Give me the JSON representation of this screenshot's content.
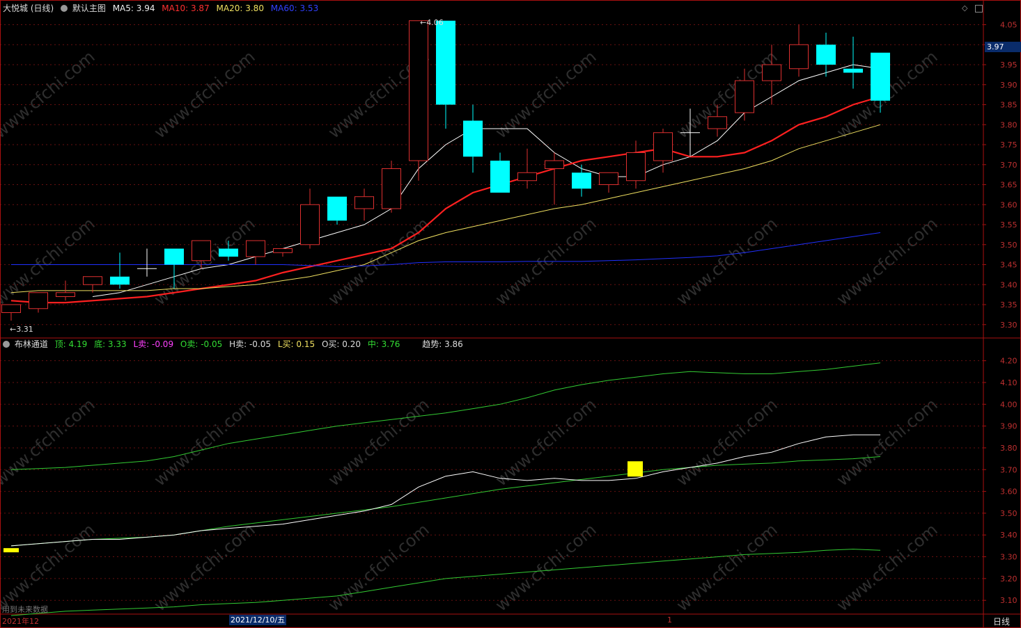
{
  "header": {
    "stock": "大悦城 (日线)",
    "main_chart": "默认主图",
    "ma5": "MA5: 3.94",
    "ma10": "MA10: 3.87",
    "ma20": "MA20: 3.80",
    "ma60": "MA60: 3.53"
  },
  "indicator_header": {
    "name": "布林通道",
    "top": "顶: 4.19",
    "bottom": "底: 3.33",
    "l_sell": "L卖: -0.09",
    "o_sell": "O卖: -0.05",
    "h_sell": "H卖: -0.05",
    "l_buy": "L买: 0.15",
    "o_buy": "O买: 0.20",
    "mid": "中: 3.76",
    "trend": "趋势: 3.86"
  },
  "footer": {
    "future_data": "用到未来数据",
    "month_label": "2021年12",
    "date_label": "2021/12/10/五",
    "month_mark": "1",
    "period": "日线"
  },
  "price_box": "3.97",
  "watermark": "www.cfchi.com",
  "colors": {
    "up": "#e03030",
    "down": "#00ffff",
    "ma5": "#ffffff",
    "ma10": "#ff2020",
    "ma20": "#f0e060",
    "ma60": "#2030ff",
    "boll": "#33cc33",
    "trend": "#ffffff",
    "signal": "#ffff00",
    "axis": "#aa1010",
    "grid": "#6a1010"
  },
  "chart_data": [
    {
      "type": "candlestick",
      "title": "大悦城 (日线)",
      "ylim": [
        3.27,
        4.07
      ],
      "yticks": [
        3.3,
        3.35,
        3.4,
        3.45,
        3.5,
        3.55,
        3.6,
        3.65,
        3.7,
        3.75,
        3.8,
        3.85,
        3.9,
        3.95,
        4.0,
        4.05
      ],
      "grid": true,
      "annotations": [
        {
          "text": "←3.31",
          "x": 0,
          "y": 3.31
        },
        {
          "text": "←4.06",
          "x": 15,
          "y": 4.06
        }
      ],
      "ohlc": [
        [
          3.33,
          3.35,
          3.31,
          3.35
        ],
        [
          3.34,
          3.38,
          3.33,
          3.38
        ],
        [
          3.37,
          3.41,
          3.36,
          3.38
        ],
        [
          3.4,
          3.42,
          3.38,
          3.42
        ],
        [
          3.42,
          3.48,
          3.39,
          3.4
        ],
        [
          3.44,
          3.49,
          3.42,
          3.44
        ],
        [
          3.49,
          3.49,
          3.39,
          3.45
        ],
        [
          3.46,
          3.51,
          3.44,
          3.51
        ],
        [
          3.49,
          3.51,
          3.46,
          3.47
        ],
        [
          3.47,
          3.51,
          3.45,
          3.51
        ],
        [
          3.48,
          3.49,
          3.47,
          3.49
        ],
        [
          3.5,
          3.64,
          3.49,
          3.6
        ],
        [
          3.62,
          3.62,
          3.55,
          3.56
        ],
        [
          3.59,
          3.64,
          3.56,
          3.62
        ],
        [
          3.59,
          3.71,
          3.58,
          3.69
        ],
        [
          3.71,
          4.06,
          3.66,
          4.06
        ],
        [
          4.06,
          4.06,
          3.79,
          3.85
        ],
        [
          3.81,
          3.85,
          3.68,
          3.72
        ],
        [
          3.71,
          3.73,
          3.63,
          3.63
        ],
        [
          3.66,
          3.74,
          3.64,
          3.68
        ],
        [
          3.69,
          3.73,
          3.6,
          3.71
        ],
        [
          3.68,
          3.7,
          3.62,
          3.64
        ],
        [
          3.65,
          3.68,
          3.63,
          3.68
        ],
        [
          3.66,
          3.76,
          3.64,
          3.73
        ],
        [
          3.71,
          3.79,
          3.68,
          3.78
        ],
        [
          3.78,
          3.84,
          3.72,
          3.78
        ],
        [
          3.79,
          3.85,
          3.77,
          3.82
        ],
        [
          3.83,
          3.94,
          3.81,
          3.91
        ],
        [
          3.91,
          4.0,
          3.85,
          3.95
        ],
        [
          3.94,
          4.05,
          3.92,
          4.0
        ],
        [
          4.0,
          4.03,
          3.92,
          3.95
        ],
        [
          3.94,
          4.02,
          3.89,
          3.93
        ],
        [
          3.98,
          3.98,
          3.83,
          3.86
        ]
      ],
      "series": [
        {
          "name": "MA5",
          "values": [
            null,
            null,
            null,
            3.37,
            3.38,
            3.4,
            3.42,
            3.44,
            3.45,
            3.47,
            3.49,
            3.51,
            3.53,
            3.55,
            3.59,
            3.69,
            3.75,
            3.79,
            3.79,
            3.79,
            3.73,
            3.69,
            3.67,
            3.67,
            3.7,
            3.72,
            3.76,
            3.83,
            3.87,
            3.91,
            3.93,
            3.95,
            3.94
          ]
        },
        {
          "name": "MA10",
          "values": [
            3.36,
            3.355,
            3.355,
            3.36,
            3.365,
            3.37,
            3.38,
            3.39,
            3.4,
            3.41,
            3.43,
            3.445,
            3.46,
            3.475,
            3.49,
            3.53,
            3.59,
            3.63,
            3.65,
            3.67,
            3.69,
            3.71,
            3.72,
            3.73,
            3.74,
            3.72,
            3.72,
            3.73,
            3.76,
            3.8,
            3.82,
            3.85,
            3.87
          ]
        },
        {
          "name": "MA20",
          "values": [
            3.38,
            3.385,
            3.385,
            3.385,
            3.385,
            3.385,
            3.39,
            3.39,
            3.395,
            3.4,
            3.41,
            3.42,
            3.435,
            3.45,
            3.48,
            3.51,
            3.53,
            3.545,
            3.56,
            3.575,
            3.59,
            3.6,
            3.615,
            3.63,
            3.645,
            3.66,
            3.675,
            3.69,
            3.71,
            3.74,
            3.76,
            3.78,
            3.8
          ]
        },
        {
          "name": "MA60",
          "values": [
            3.45,
            3.45,
            3.45,
            3.45,
            3.45,
            3.45,
            3.45,
            3.45,
            3.45,
            3.45,
            3.45,
            3.448,
            3.445,
            3.447,
            3.45,
            3.455,
            3.457,
            3.457,
            3.457,
            3.458,
            3.458,
            3.458,
            3.46,
            3.462,
            3.465,
            3.468,
            3.472,
            3.48,
            3.49,
            3.5,
            3.51,
            3.52,
            3.53
          ]
        }
      ]
    },
    {
      "type": "line",
      "title": "布林通道",
      "ylim": [
        3.04,
        4.25
      ],
      "yticks": [
        3.1,
        3.2,
        3.3,
        3.4,
        3.5,
        3.6,
        3.7,
        3.8,
        3.9,
        4.0,
        4.1,
        4.2
      ],
      "grid": true,
      "series": [
        {
          "name": "顶",
          "values": [
            3.7,
            3.705,
            3.71,
            3.72,
            3.73,
            3.74,
            3.76,
            3.79,
            3.82,
            3.84,
            3.86,
            3.88,
            3.9,
            3.915,
            3.93,
            3.945,
            3.96,
            3.98,
            4.0,
            4.03,
            4.065,
            4.09,
            4.11,
            4.125,
            4.14,
            4.15,
            4.145,
            4.14,
            4.14,
            4.15,
            4.16,
            4.175,
            4.19
          ]
        },
        {
          "name": "中",
          "values": [
            3.35,
            3.36,
            3.37,
            3.38,
            3.385,
            3.39,
            3.4,
            3.42,
            3.44,
            3.455,
            3.47,
            3.485,
            3.5,
            3.515,
            3.53,
            3.55,
            3.57,
            3.59,
            3.61,
            3.625,
            3.64,
            3.655,
            3.67,
            3.685,
            3.7,
            3.71,
            3.72,
            3.725,
            3.73,
            3.74,
            3.745,
            3.75,
            3.76
          ]
        },
        {
          "name": "底",
          "values": [
            3.03,
            3.04,
            3.05,
            3.055,
            3.06,
            3.065,
            3.07,
            3.08,
            3.085,
            3.09,
            3.1,
            3.11,
            3.12,
            3.14,
            3.16,
            3.18,
            3.2,
            3.21,
            3.22,
            3.23,
            3.24,
            3.25,
            3.26,
            3.27,
            3.28,
            3.29,
            3.3,
            3.31,
            3.315,
            3.32,
            3.33,
            3.335,
            3.33
          ]
        },
        {
          "name": "趋势",
          "values": [
            3.35,
            3.36,
            3.37,
            3.38,
            3.38,
            3.39,
            3.4,
            3.42,
            3.43,
            3.44,
            3.45,
            3.47,
            3.49,
            3.51,
            3.54,
            3.62,
            3.67,
            3.69,
            3.66,
            3.65,
            3.66,
            3.65,
            3.65,
            3.66,
            3.69,
            3.71,
            3.73,
            3.76,
            3.78,
            3.82,
            3.85,
            3.86,
            3.86
          ]
        }
      ],
      "signals": [
        {
          "x": 0,
          "y": 3.33
        },
        {
          "x": 23,
          "y": 3.7
        }
      ]
    }
  ]
}
